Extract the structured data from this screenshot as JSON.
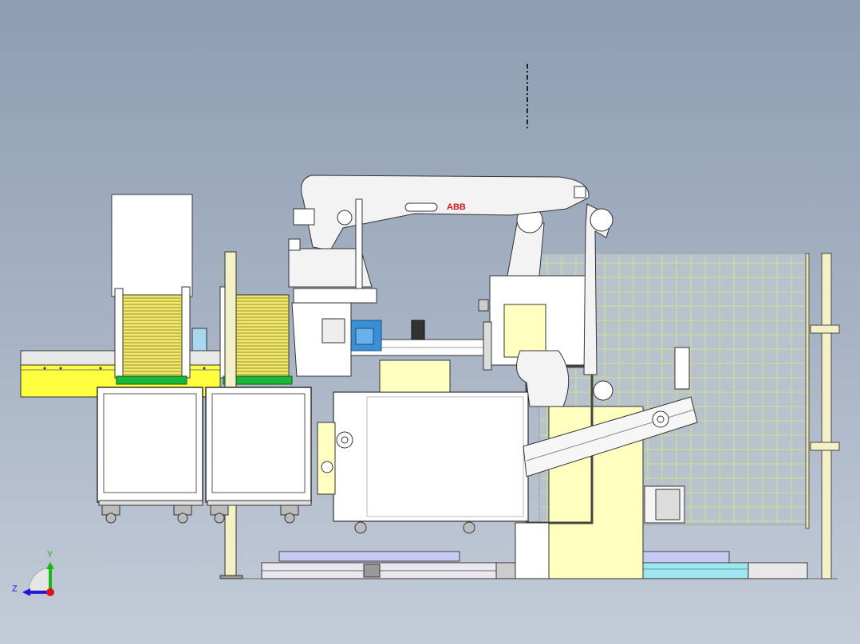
{
  "viewport": {
    "background_top": "#8e9db2",
    "background_bottom": "#c4ccd8"
  },
  "robot": {
    "brand_text": "ABB",
    "body_color": "#f3f3f3",
    "brand_color": "#d21a1a"
  },
  "colors": {
    "line": "#333333",
    "machine_white": "#ffffff",
    "pale_yellow": "#ffffc0",
    "bright_yellow": "#ffff40",
    "stack_yellow": "#f2e86a",
    "green_rail": "#19b83a",
    "cyan_part": "#9fe7ef",
    "lavender_part": "#c8c8f4",
    "fence_mesh": "#c7d77c",
    "blue_block": "#3b8fd6"
  },
  "triad": {
    "x_axis_label": "Y",
    "z_axis_label": "Z",
    "x_color": "#18b818",
    "z_color": "#1a1ad8",
    "origin_color": "#e01010"
  }
}
